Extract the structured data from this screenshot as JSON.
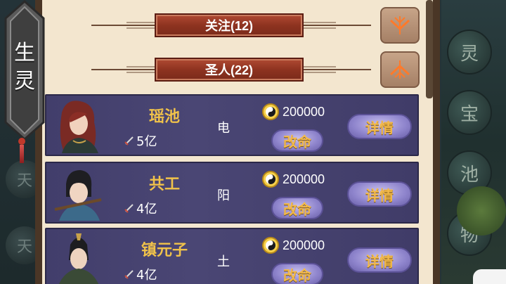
{
  "side_tab": {
    "label_line1": "生",
    "label_line2": "灵"
  },
  "background": {
    "right_glyphs": [
      "灵",
      "宝",
      "池",
      "物"
    ],
    "left_glyphs": [
      "天",
      "天"
    ]
  },
  "sections": [
    {
      "label": "关注(12)",
      "toggle": "collapse"
    },
    {
      "label": "圣人(22)",
      "toggle": "expand"
    }
  ],
  "characters": [
    {
      "name": "瑶池",
      "power": "5亿",
      "element": "电",
      "price": "200000",
      "change_label": "改命",
      "detail_label": "详情"
    },
    {
      "name": "共工",
      "power": "4亿",
      "element": "阳",
      "price": "200000",
      "change_label": "改命",
      "detail_label": "详情"
    },
    {
      "name": "镇元子",
      "power": "4亿",
      "element": "土",
      "price": "200000",
      "change_label": "改命",
      "detail_label": "详情"
    }
  ],
  "colors": {
    "panel_bg": "#f3e6cf",
    "banner_red": "#8e3320",
    "row_purple": "#4a4674",
    "name_gold": "#f0c24a",
    "button_text_gold": "#f2b94a"
  },
  "icons": {
    "sword": "sword-icon",
    "coin": "coin-icon",
    "collapse": "chevron-down-icon",
    "expand": "chevron-up-icon"
  }
}
